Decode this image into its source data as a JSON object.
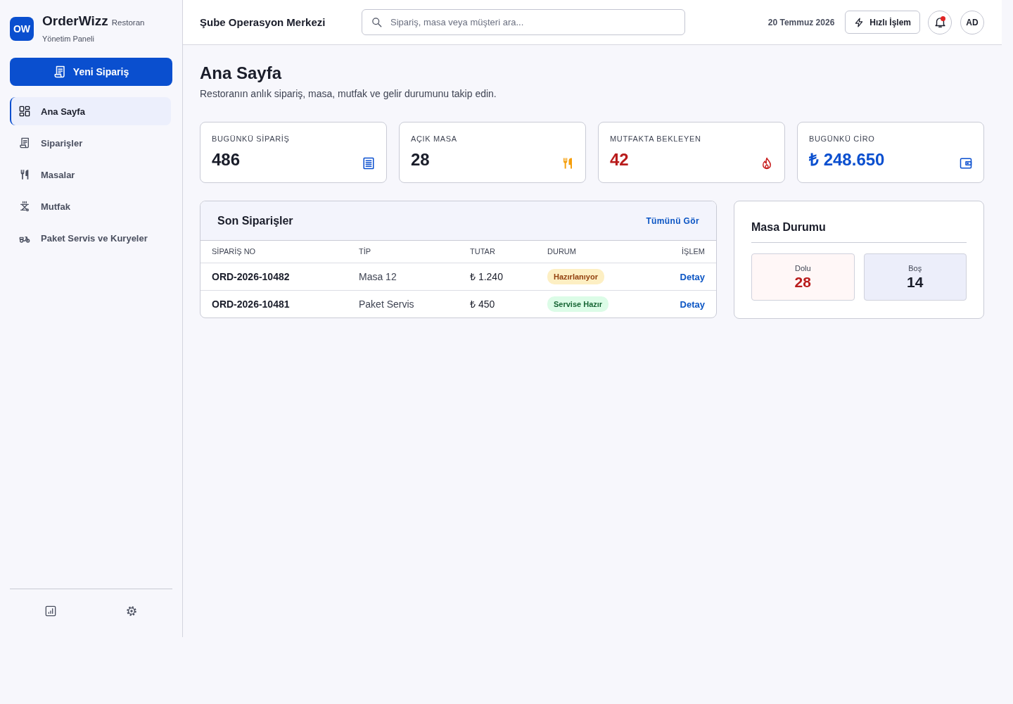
{
  "sidebar": {
    "brand": {
      "logo": "OW",
      "name": "OrderWizz",
      "tag": "Restoran",
      "subtitle": "Yönetim Paneli"
    },
    "new_order_button": "Yeni Sipariş",
    "nav": [
      {
        "label": "Ana Sayfa",
        "kind": "dashboard",
        "selected": true
      },
      {
        "label": "Siparişler",
        "kind": "orders",
        "selected": false
      },
      {
        "label": "Masalar",
        "kind": "tables",
        "selected": false
      },
      {
        "label": "Mutfak",
        "kind": "kitchen",
        "selected": false
      },
      {
        "label": "Paket Servis ve Kuryeler",
        "kind": "delivery",
        "selected": false
      }
    ]
  },
  "header": {
    "title": "Şube Operasyon Merkezi",
    "search": {
      "placeholder": "Sipariş, masa veya müşteri ara..."
    },
    "date": "20 Temmuz 2026",
    "quick_action": "Hızlı İşlem",
    "notifications": {
      "unread": true
    },
    "avatar": "AD"
  },
  "page": {
    "title": "Ana Sayfa",
    "subtitle": "Restoranın anlık sipariş, masa, mutfak ve gelir durumunu takip edin."
  },
  "stats": [
    {
      "label": "BUGÜNKÜ SİPARİŞ",
      "value": "486",
      "kind": "orders"
    },
    {
      "label": "AÇIK MASA",
      "value": "28",
      "kind": "tables"
    },
    {
      "label": "MUTFAKTA BEKLEYEN",
      "value": "42",
      "kind": "kitchen"
    },
    {
      "label": "BUGÜNKÜ CİRO",
      "value": "₺ 248.650",
      "kind": "revenue"
    }
  ],
  "recent_orders": {
    "title": "Son Siparişler",
    "link": "Tümünü Gör",
    "columns": [
      "SİPARİŞ NO",
      "TİP",
      "TUTAR",
      "DURUM",
      "İŞLEM"
    ],
    "rows": [
      {
        "order_no": "ORD-2026-10482",
        "type": "Masa 12",
        "amount": "₺ 1.240",
        "status": {
          "label": "Hazırlanıyor",
          "kind": "preparing"
        },
        "action": "Detay"
      },
      {
        "order_no": "ORD-2026-10481",
        "type": "Paket Servis",
        "amount": "₺ 450",
        "status": {
          "label": "Servise Hazır",
          "kind": "ready"
        },
        "action": "Detay"
      }
    ]
  },
  "table_status": {
    "title": "Masa Durumu",
    "tiles": [
      {
        "label": "Dolu",
        "value": "28",
        "kind": "occupied"
      },
      {
        "label": "Boş",
        "value": "14",
        "kind": "free"
      }
    ]
  }
}
